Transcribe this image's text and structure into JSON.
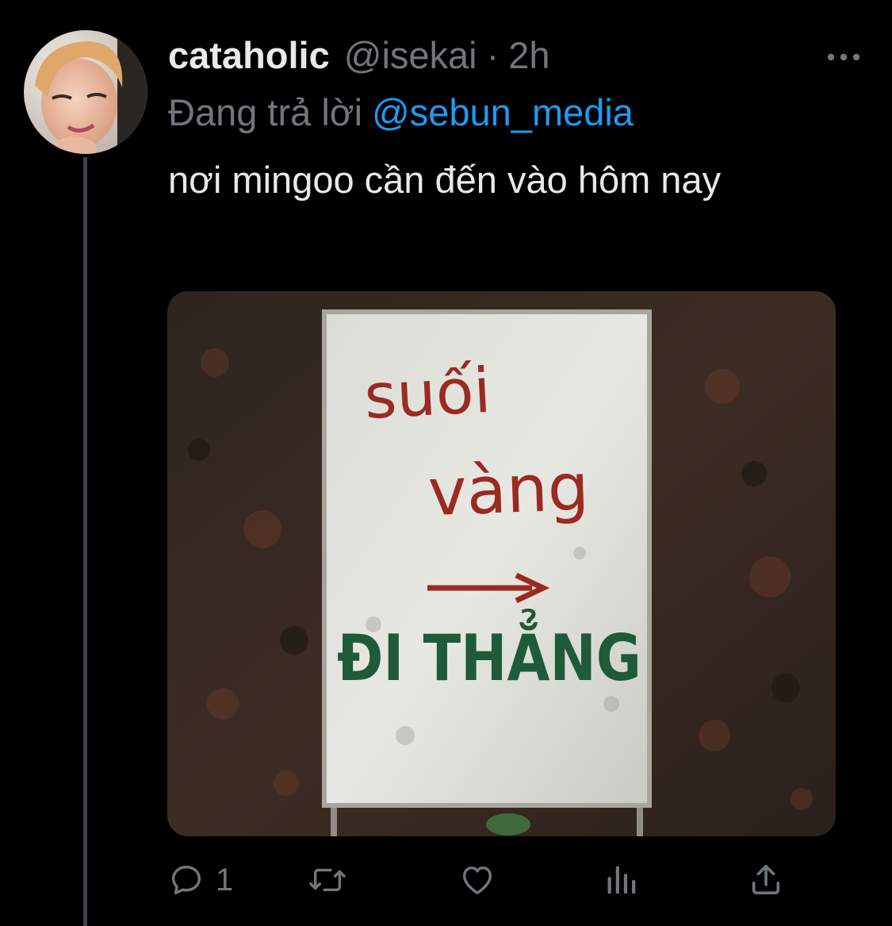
{
  "colors": {
    "background": "#000000",
    "text_primary": "#e7e9ea",
    "text_secondary": "#71767b",
    "accent": "#1d9bf0",
    "thread_line": "#3d4246"
  },
  "tweet": {
    "display_name": "cataholic",
    "handle": "@isekai",
    "separator": "·",
    "time": "2h",
    "reply_prefix": "Đang trả lời",
    "reply_to": "@sebun_media",
    "text": "nơi mingoo cần đến vào hôm nay",
    "avatar_icon": "user-avatar",
    "more_icon": "more-horizontal-icon"
  },
  "media": {
    "sign_line1": "suối",
    "sign_line2": "vàng",
    "sign_line3": "ĐI THẲNG"
  },
  "actions": {
    "reply": {
      "icon": "reply-icon",
      "count": "1"
    },
    "retweet": {
      "icon": "retweet-icon"
    },
    "like": {
      "icon": "heart-icon"
    },
    "analytics": {
      "icon": "analytics-icon"
    },
    "share": {
      "icon": "share-icon"
    }
  }
}
